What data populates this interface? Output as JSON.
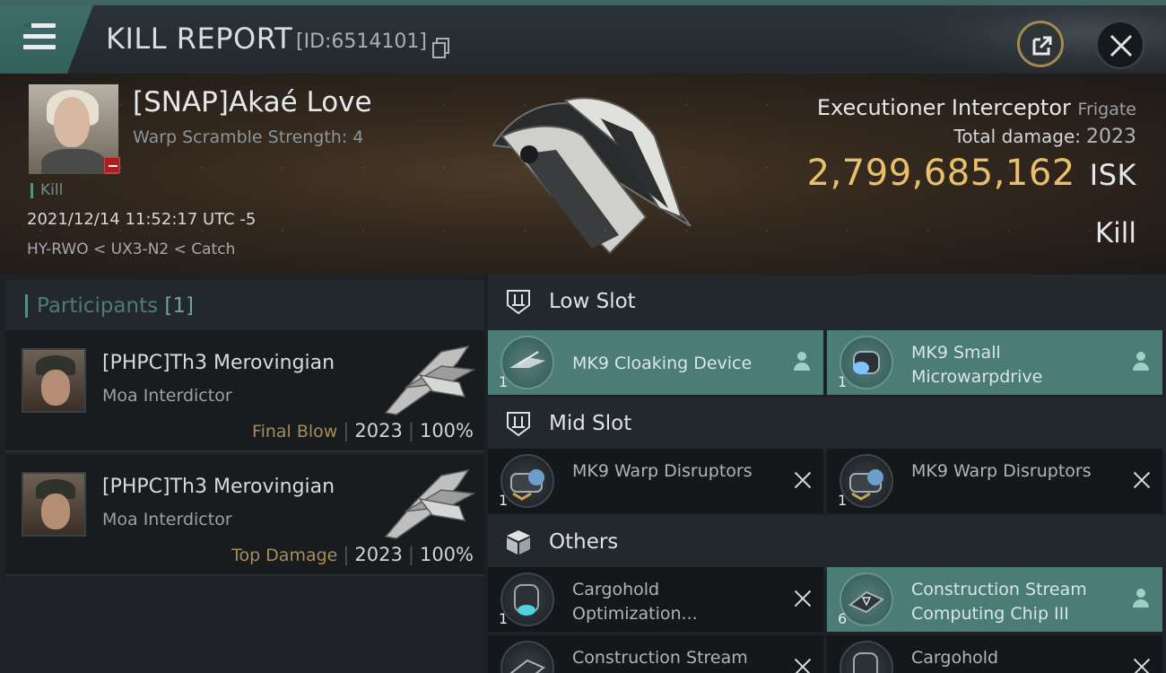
{
  "titlebar": {
    "title": "KILL REPORT",
    "kill_id": "[ID:6514101]"
  },
  "victim": {
    "name": "[SNAP]Akaé Love",
    "subtitle": "Warp Scramble Strength: 4",
    "tag": "Kill",
    "datetime": "2021/12/14 11:52:17 UTC -5",
    "location": "HY-RWO < UX3-N2 < Catch"
  },
  "ship": {
    "name": "Executioner Interceptor",
    "class": "Frigate",
    "total_damage_label": "Total damage:",
    "total_damage_value": "2023",
    "isk_value": "2,799,685,162",
    "isk_unit": "ISK",
    "result": "Kill"
  },
  "participants": {
    "label": "Participants",
    "count": "[1]",
    "rows": [
      {
        "name": "[PHPC]Th3 Merovingian",
        "ship": "Moa Interdictor",
        "role": "Final Blow",
        "damage": "2023",
        "percent": "100%"
      },
      {
        "name": "[PHPC]Th3 Merovingian",
        "ship": "Moa Interdictor",
        "role": "Top Damage",
        "damage": "2023",
        "percent": "100%"
      }
    ]
  },
  "sections": {
    "low": "Low Slot",
    "mid": "Mid Slot",
    "others": "Others"
  },
  "modules": {
    "low": [
      {
        "name": "MK9 Cloaking Device",
        "qty": "1",
        "status": "dropped"
      },
      {
        "name": "MK9 Small Microwarpdrive",
        "qty": "1",
        "status": "dropped"
      }
    ],
    "mid": [
      {
        "name": "MK9 Warp Disruptors",
        "qty": "1",
        "status": "destroyed"
      },
      {
        "name": "MK9 Warp Disruptors",
        "qty": "1",
        "status": "destroyed"
      }
    ],
    "others": [
      {
        "name": "Cargohold Optimization...",
        "qty": "1",
        "status": "destroyed"
      },
      {
        "name": "Construction Stream Computing Chip III",
        "qty": "6",
        "status": "dropped"
      },
      {
        "name": "Construction Stream",
        "qty": "",
        "status": "destroyed"
      },
      {
        "name": "Cargohold",
        "qty": "",
        "status": "destroyed"
      }
    ]
  },
  "colors": {
    "accent_teal": "#4c7c76",
    "isk_gold": "#e8c06a",
    "role_gold": "#a48d5b",
    "badge_red": "#b11d1d"
  },
  "icons": {
    "menu": "hamburger-icon",
    "copy": "copy-icon",
    "share": "external-link-icon",
    "close": "close-icon",
    "low_slot": "low-slot-icon",
    "mid_slot": "mid-slot-icon",
    "others": "cube-icon",
    "dropped": "person-icon",
    "destroyed": "x-icon"
  }
}
